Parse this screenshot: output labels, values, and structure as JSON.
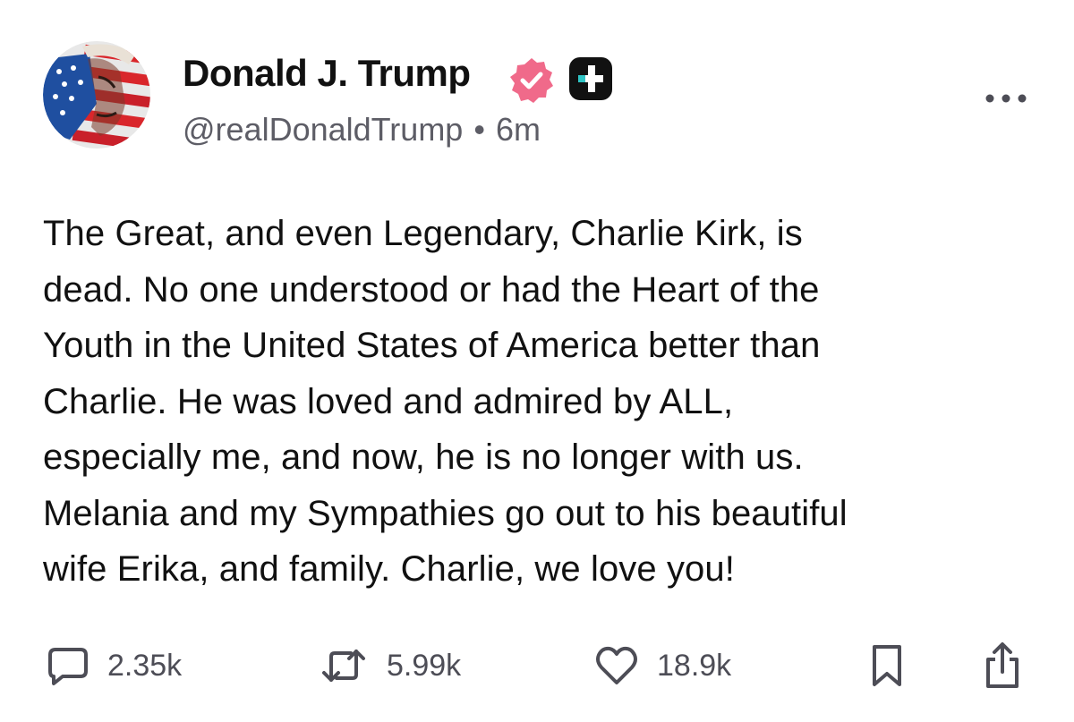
{
  "post": {
    "author": {
      "name": "Donald J. Trump",
      "handle": "@realDonaldTrump",
      "separator": "•",
      "time": "6m"
    },
    "body": "The Great, and even Legendary, Charlie Kirk, is\ndead. No one understood or had the Heart of the\nYouth in the United States of America better than\nCharlie. He was loved and admired by ALL,\nespecially me, and now, he is no longer with us.\nMelania and my Sympathies go out to his beautiful\nwife Erika, and family. Charlie, we love you!",
    "actions": {
      "replies": "2.35k",
      "reposts": "5.99k",
      "likes": "18.9k"
    }
  },
  "icons": {
    "avatar": "profile-photo-flag-face",
    "verified": "verified-badge-icon",
    "plus": "plus-badge-icon",
    "more": "more-dots-icon",
    "reply": "reply-bubble-icon",
    "repost": "repost-icon",
    "like": "heart-icon",
    "bookmark": "bookmark-icon",
    "share": "share-icon"
  },
  "colors": {
    "verified": "#f06a8a",
    "plus_badge": "#111111",
    "plus_accent": "#2ec4c4",
    "icon_gray": "#4d4d56",
    "handle_gray": "#5d5d66"
  }
}
